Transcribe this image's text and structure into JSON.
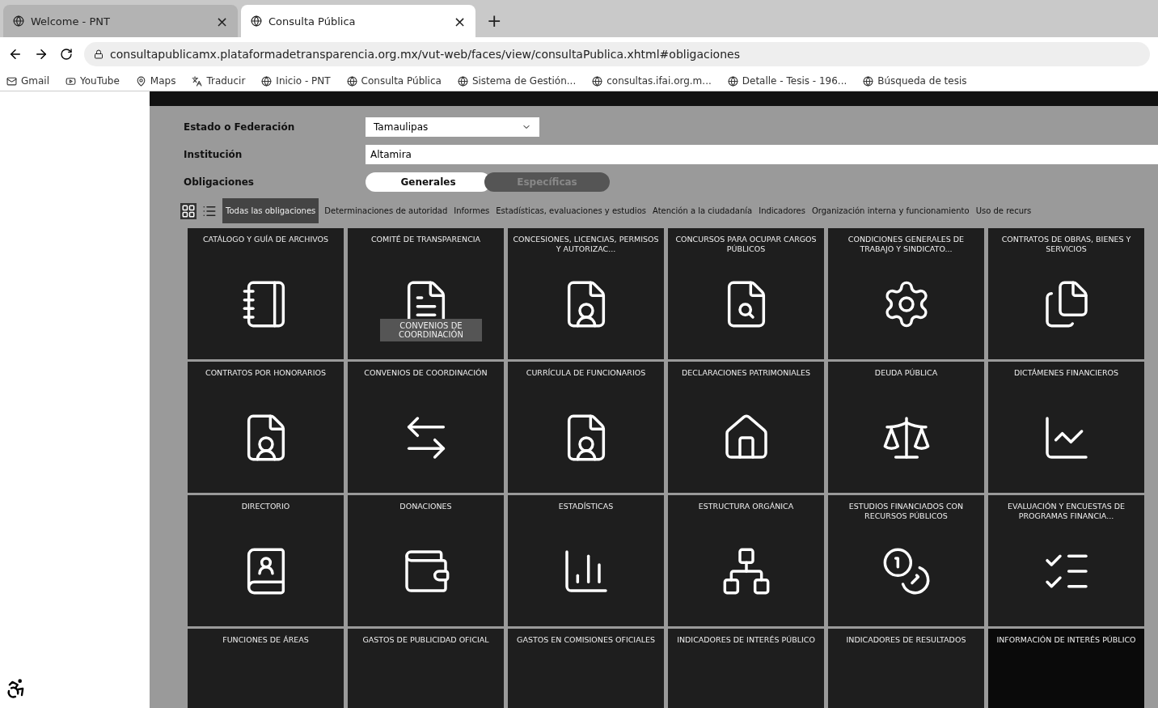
{
  "browser": {
    "tabs": [
      {
        "title": "Welcome - PNT",
        "selected": false,
        "close": "×"
      },
      {
        "title": "Consulta Pública",
        "selected": true,
        "close": "×"
      }
    ],
    "new_tab": "+",
    "address": "consultapublicamx.plataformadetransparencia.org.mx/vut-web/faces/view/consultaPublica.xhtml#obligaciones",
    "bookmarks": [
      "Gmail",
      "YouTube",
      "Maps",
      "Traducir",
      "Inicio - PNT",
      "Consulta Pública",
      "Sistema de Gestión...",
      "consultas.ifai.org.m...",
      "Detalle - Tesis - 196...",
      "Búsqueda de tesis"
    ]
  },
  "form": {
    "estado": {
      "label": "Estado o Federación",
      "value": "Tamaulipas"
    },
    "institucion": {
      "label": "Institución",
      "value": "Altamira"
    },
    "obligaciones": {
      "label": "Obligaciones",
      "options": [
        {
          "label": "Generales",
          "selected": true
        },
        {
          "label": "Específicas",
          "selected": false
        }
      ]
    }
  },
  "view_modes": [
    {
      "kind": "grid",
      "selected": true
    },
    {
      "kind": "list",
      "selected": false
    }
  ],
  "categories": [
    {
      "label": "Todas las obligaciones",
      "selected": true
    },
    {
      "label": "Determinaciones de autoridad",
      "selected": false
    },
    {
      "label": "Informes",
      "selected": false
    },
    {
      "label": "Estadísticas, evaluaciones y estudios",
      "selected": false
    },
    {
      "label": "Atención a la ciudadanía",
      "selected": false
    },
    {
      "label": "Indicadores",
      "selected": false
    },
    {
      "label": "Organización interna y funcionamiento",
      "selected": false
    },
    {
      "label": "Uso de recurs",
      "selected": false
    }
  ],
  "tiles": [
    {
      "title": "CATÁLOGO Y GUÍA DE ARCHIVOS"
    },
    {
      "title": "COMITÉ DE TRANSPARENCIA",
      "tooltip": "CONVENIOS DE COORDINACIÓN"
    },
    {
      "title": "CONCESIONES, LICENCIAS, PERMISOS Y AUTORIZAC..."
    },
    {
      "title": "CONCURSOS PARA OCUPAR CARGOS PÚBLICOS"
    },
    {
      "title": "CONDICIONES GENERALES DE TRABAJO Y SINDICATO..."
    },
    {
      "title": "CONTRATOS DE OBRAS, BIENES Y SERVICIOS"
    },
    {
      "title": "CONTRATOS POR HONORARIOS"
    },
    {
      "title": "CONVENIOS DE COORDINACIÓN"
    },
    {
      "title": "CURRÍCULA DE FUNCIONARIOS"
    },
    {
      "title": "DECLARACIONES PATRIMONIALES"
    },
    {
      "title": "DEUDA PÚBLICA"
    },
    {
      "title": "DICTÁMENES FINANCIEROS"
    },
    {
      "title": "DIRECTORIO"
    },
    {
      "title": "DONACIONES"
    },
    {
      "title": "ESTADÍSTICAS"
    },
    {
      "title": "ESTRUCTURA ORGÁNICA"
    },
    {
      "title": "ESTUDIOS FINANCIADOS CON RECURSOS PÚBLICOS"
    },
    {
      "title": "EVALUACIÓN Y ENCUESTAS DE PROGRAMAS FINANCIA..."
    },
    {
      "title": "FUNCIONES DE ÁREAS"
    },
    {
      "title": "GASTOS DE PUBLICIDAD OFICIAL"
    },
    {
      "title": "GASTOS EN COMISIONES OFICIALES"
    },
    {
      "title": "INDICADORES DE INTERÉS PÚBLICO"
    },
    {
      "title": "INDICADORES DE RESULTADOS"
    },
    {
      "title": "INFORMACIÓN DE INTERÉS PÚBLICO"
    }
  ]
}
